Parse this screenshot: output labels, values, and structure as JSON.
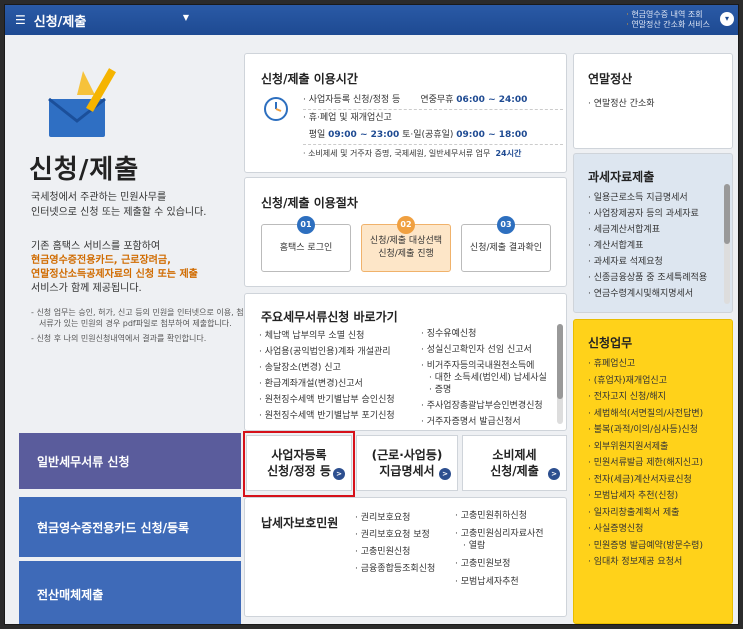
{
  "topbar": {
    "menu_label": "신청/제출",
    "links": [
      "현금영수증 내역 조회",
      "연말정산 간소화 서비스"
    ]
  },
  "hero": {
    "title": "신청/제출",
    "desc_line1": "국세청에서 주관하는 민원사무를",
    "desc_line2": "인터넷으로 신청 또는 제출할 수 있습니다.",
    "desc2_intro": "기존 홈택스 서비스를 포함하여",
    "desc2_hl1": "현금영수증전용카드, 근로장려금,",
    "desc2_hl2": "연말정산소득공제자료의 신청 또는 제출",
    "desc2_tail": "서비스가 함께 제공됩니다.",
    "note1": "신청 업무는 승인, 허가, 신고 등의 민원을 인터넷으로 이용, 첨부서류가 있는 민원의 경우 pdf파일로 첨부하여 제출합니다.",
    "note2": "신청 후 나의 민원신청내역에서 결과를 확인합니다."
  },
  "left_buttons": {
    "b1": "일반세무서류 신청",
    "b2": "현금영수증전용카드 신청/등록",
    "b3": "전산매체제출"
  },
  "time_card": {
    "title": "신청/제출 이용시간",
    "r1_label": "· 사업자등록 신청/정정 등",
    "r1_prefix": "연중무휴 ",
    "r1_time": "06:00 ~ 24:00",
    "r2_label": "· 휴·폐업 및 재개업신고",
    "r3_prefix": "평일 ",
    "r3_time1": "09:00 ~ 23:00",
    "r3_mid": " 토·일(공휴일) ",
    "r3_time2": "09:00 ~ 18:00",
    "r4_label": "· 소비제세 및 거주자 증명, 국제세원, 일반세무서류 업무",
    "r4_time": "24시간"
  },
  "proc_card": {
    "title": "신청/제출 이용절차",
    "steps": [
      {
        "num": "01",
        "label1": "홈택스 로그인",
        "label2": ""
      },
      {
        "num": "02",
        "label1": "신청/제출 대상선택",
        "label2": "신청/제출 진행"
      },
      {
        "num": "03",
        "label1": "신청/제출 결과확인",
        "label2": ""
      }
    ]
  },
  "tax_card": {
    "title": "주요세무서류신청 바로가기",
    "col1": [
      "체납액 납부의무 소멸 신청",
      "사업용(공익법인용)계좌 개설관리",
      "송달장소(변경) 신고",
      "환급계좌개설(변경)신고서",
      "원천징수세액 반기별납부 승인신청",
      "원천징수세액 반기별납부 포기신청"
    ],
    "col2": [
      "징수유예신청",
      "성실신고확인자 선임 신고서",
      "비거주자등의국내원천소득에",
      "대한 소득세(법인세) 납세사실",
      "증명",
      "주사업장총괄납부승인변경신청",
      "거주자증명서 발급신청서"
    ]
  },
  "big_buttons": {
    "b1_l1": "사업자등록",
    "b1_l2": "신청/정정 등",
    "b2_l1": "(근로·사업등)",
    "b2_l2": "지급명세서",
    "b3_l1": "소비제세",
    "b3_l2": "신청/제출"
  },
  "prot_card": {
    "title": "납세자보호민원",
    "col1": [
      "권리보호요청",
      "권리보호요청 보정",
      "고충민원신청",
      "금융종합등조회신청"
    ],
    "col2": [
      "고충민원취하신청",
      "고충민원심리자료사전",
      "열람",
      "고충민원보정",
      "모범납세자추천"
    ]
  },
  "year_card": {
    "title": "연말정산",
    "item": "· 연말정산 간소화"
  },
  "doc_card": {
    "title": "과세자료제출",
    "items": [
      "일용근로소득 지급명세서",
      "사업장제공자 등의 과세자료",
      "세금계산서합계표",
      "계산서합계표",
      "과세자료 석제요청",
      "신종금융상품 중 조세특례적용",
      "연금수령계시및해지명세서"
    ]
  },
  "app_card": {
    "title": "신청업무",
    "items": [
      "휴폐업신고",
      "(휴업자)재개업신고",
      "전자고지 신청/해지",
      "세법해석(서면질의/사전답변)",
      "불복(과적/이의/심사등)신청",
      "외부위원지원서제출",
      "민원서류발급 제한(해지신고)",
      "전자(세금)계산서자료신청",
      "모범납세자 추천(신청)",
      "일자리창출계획서 제출",
      "사실증명신청",
      "민원증명 발급예약(방문수령)",
      "임대차 정보제공 요청서"
    ]
  },
  "colors": {
    "topbar": "#1e4a92",
    "left_btn_purple": "#5a5c9c",
    "left_btn_blue": "#3e6ab8",
    "highlight_red": "#d6111a",
    "app_yellow": "#ffd21a",
    "step_blue": "#2d6fbf",
    "step_orange": "#f0a040"
  }
}
